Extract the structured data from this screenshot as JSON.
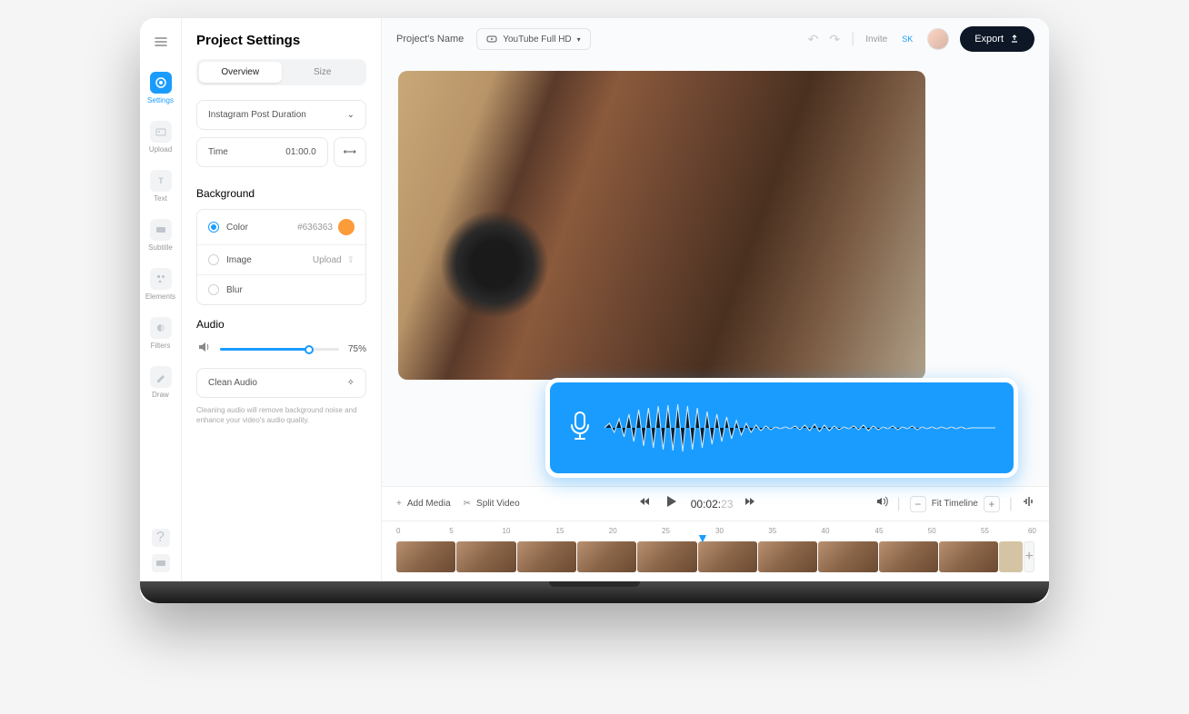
{
  "sidebar": {
    "items": [
      {
        "label": "Settings"
      },
      {
        "label": "Upload"
      },
      {
        "label": "Text"
      },
      {
        "label": "Subtitle"
      },
      {
        "label": "Elements"
      },
      {
        "label": "Filters"
      },
      {
        "label": "Draw"
      }
    ]
  },
  "panel": {
    "title": "Project Settings",
    "tabs": {
      "overview": "Overview",
      "size": "Size"
    },
    "duration": {
      "label": "Instagram Post Duration"
    },
    "time": {
      "label": "Time",
      "value": "01:00.0"
    },
    "background": {
      "heading": "Background",
      "color": {
        "label": "Color",
        "hex": "#636363"
      },
      "image": {
        "label": "Image",
        "upload": "Upload"
      },
      "blur": {
        "label": "Blur"
      }
    },
    "audio": {
      "heading": "Audio",
      "volume": "75%",
      "clean": "Clean Audio",
      "help": "Cleaning audio will remove background noise and enhance your video's audio quality."
    }
  },
  "topbar": {
    "project": "Project's Name",
    "preset": "YouTube Full HD",
    "invite": "Invite",
    "sk": "SK",
    "export": "Export"
  },
  "controls": {
    "addMedia": "Add Media",
    "split": "Split Video",
    "time": "00:02:",
    "timeDim": "23",
    "fit": "Fit Timeline"
  },
  "ruler": [
    "0",
    "5",
    "10",
    "15",
    "20",
    "25",
    "30",
    "35",
    "40",
    "45",
    "50",
    "55",
    "60"
  ]
}
